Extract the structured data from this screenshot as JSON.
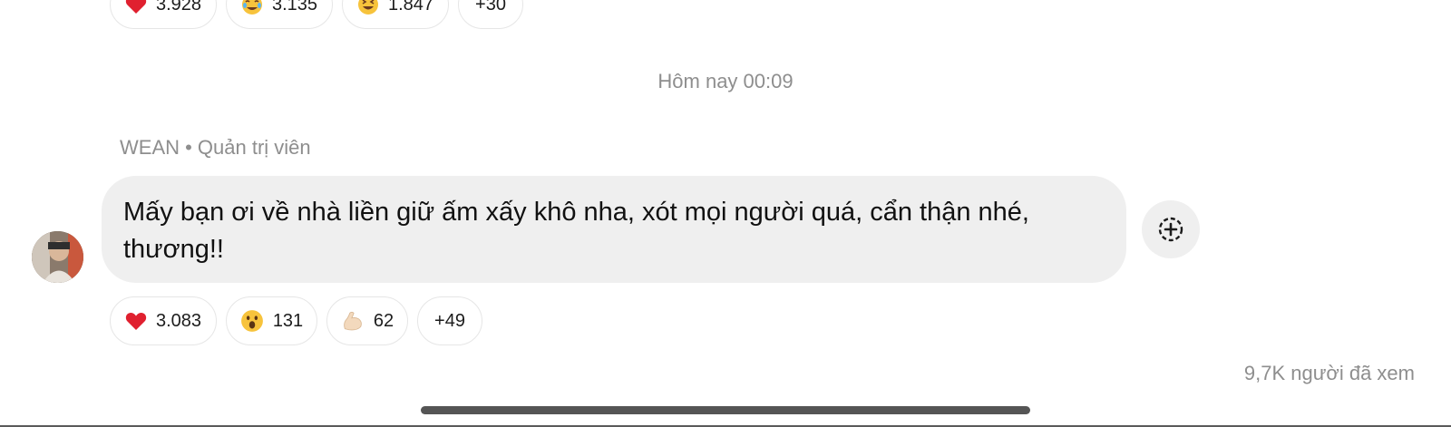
{
  "previous_reactions": [
    {
      "icon": "red-heart",
      "count": "3.928"
    },
    {
      "icon": "tears-of-joy",
      "count": "3.135"
    },
    {
      "icon": "grinning-squinting",
      "count": "1.847"
    },
    {
      "icon": "",
      "count": "+30"
    }
  ],
  "timestamp": "Hôm nay 00:09",
  "message": {
    "sender_line": "WEAN • Quản trị viên",
    "text": "Mấy bạn ơi về nhà liền giữ ấm xấy khô nha, xót mọi người quá, cẩn thận nhé, thương!!",
    "reactions": [
      {
        "icon": "red-heart",
        "count": "3.083"
      },
      {
        "icon": "astonished-face",
        "count": "131"
      },
      {
        "icon": "flexed-biceps",
        "count": "62"
      },
      {
        "icon": "",
        "count": "+49"
      }
    ]
  },
  "views": "9,7K người đã xem",
  "colors": {
    "bubble": "#efefef",
    "muted_text": "#8e8e8e",
    "heart": "#e0202f",
    "pill_border": "#e6e6e6"
  }
}
